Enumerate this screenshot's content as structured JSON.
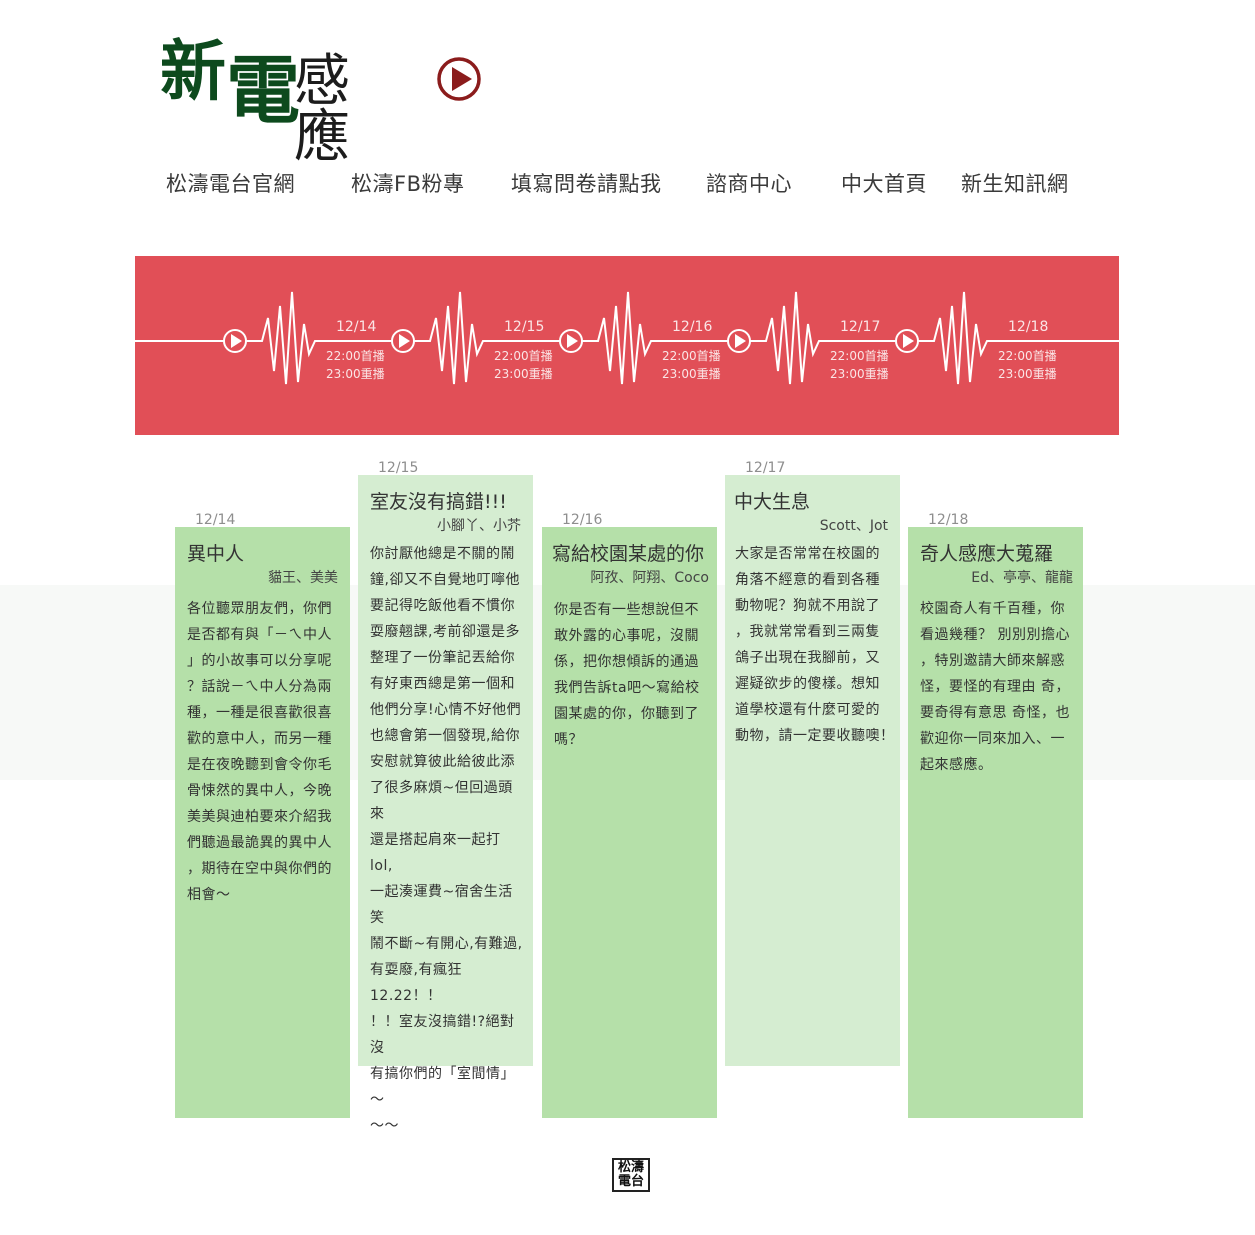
{
  "logo": {
    "char1": "新",
    "char2": "電",
    "subtitle": "感應",
    "play_icon": "play-circle-icon",
    "accent": "#8b1c1c"
  },
  "nav": [
    "松濤電台官網",
    "松濤FB粉專",
    "填寫問卷請點我",
    "諮商中心",
    "中大首頁",
    "新生知訊網"
  ],
  "banner": {
    "color": "#e14f57",
    "episodes": [
      {
        "date": "12/14",
        "first": "22:00首播",
        "replay": "23:00重播"
      },
      {
        "date": "12/15",
        "first": "22:00首播",
        "replay": "23:00重播"
      },
      {
        "date": "12/16",
        "first": "22:00首播",
        "replay": "23:00重播"
      },
      {
        "date": "12/17",
        "first": "22:00首播",
        "replay": "23:00重播"
      },
      {
        "date": "12/18",
        "first": "22:00首播",
        "replay": "23:00重播"
      }
    ]
  },
  "cards": [
    {
      "date": "12/14",
      "title": "異中人",
      "author": "貓王、美美",
      "lines": [
        "各位聽眾朋友們，你們",
        "是否都有與「－ㄟ中人",
        "」的小故事可以分享呢",
        "？話說－ㄟ中人分為兩",
        "種，一種是很喜歡很喜",
        "歡的意中人，而另一種",
        "是在夜晚聽到會令你毛",
        "骨悚然的異中人，今晚",
        "美美與迪柏要來介紹我",
        "們聽過最詭異的異中人",
        "，期待在空中與你們的",
        "相會～"
      ]
    },
    {
      "date": "12/15",
      "title": "室友沒有搞錯!!!",
      "author": "小腳丫、小芥",
      "lines": [
        "你討厭他總是不關的鬧",
        "鐘,卻又不自覺地叮嚀他",
        "要記得吃飯他看不慣你",
        "耍廢翹課,考前卻還是多",
        "整理了一份筆記丟給你",
        "有好東西總是第一個和",
        "他們分享!心情不好他們",
        "也總會第一個發現,給你",
        "安慰就算彼此給彼此添",
        "了很多麻煩~但回過頭來",
        "還是搭起肩來一起打lol,",
        "一起湊運費~宿舍生活笑",
        "鬧不斷~有開心,有難過,",
        "有耍廢,有瘋狂12.22！！",
        "！！室友沒搞錯!?絕對沒",
        "有搞你們的「室間情」～",
        "～～"
      ]
    },
    {
      "date": "12/16",
      "title": "寫給校園某處的你",
      "author": "阿孜、阿翔、Coco",
      "lines": [
        "你是否有一些想說但不",
        "敢外露的心事呢，沒關",
        "係，把你想傾訴的通過",
        "我們告訴ta吧～寫給校",
        "園某處的你，你聽到了",
        "嗎？"
      ]
    },
    {
      "date": "12/17",
      "title": "中大生息",
      "author": "Scott、Jot",
      "lines": [
        "大家是否常常在校園的",
        "角落不經意的看到各種",
        "動物呢？狗就不用說了",
        "，我就常常看到三兩隻",
        "鴿子出現在我腳前，又",
        "遲疑欲步的傻樣。想知",
        "道學校還有什麼可愛的",
        "動物，請一定要收聽噢！"
      ]
    },
    {
      "date": "12/18",
      "title": "奇人感應大蒐羅",
      "author": "Ed、亭亭、龍龍",
      "lines": [
        "校園奇人有千百種，你",
        "看過幾種？ 別別別擔心",
        "，特別邀請大師來解惑",
        "怪，要怪的有理由 奇，",
        "要奇得有意思 奇怪，也",
        "歡迎你一同來加入、一",
        "起來感應。"
      ]
    }
  ],
  "footer": {
    "seal_top": "松濤",
    "seal_bottom": "電台"
  }
}
